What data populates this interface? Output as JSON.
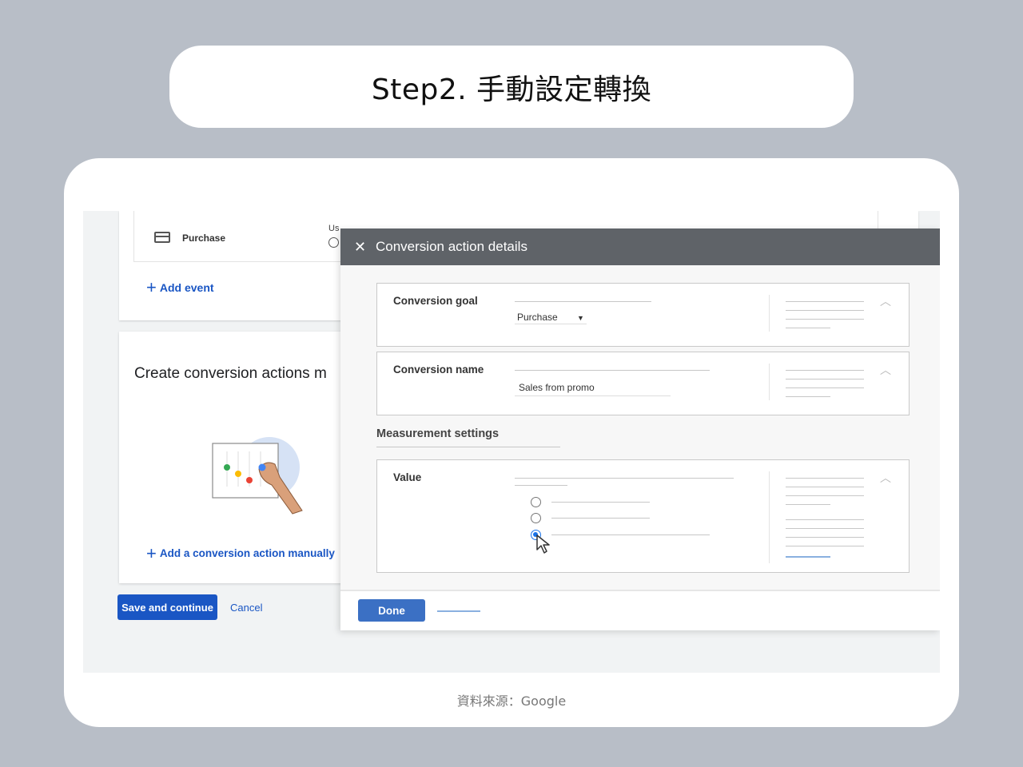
{
  "slide": {
    "title": "Step2. 手動設定轉換",
    "source": "資料來源：Google"
  },
  "background_page": {
    "event_row": {
      "icon": "credit-card-icon",
      "label": "Purchase",
      "cut_text": "Us"
    },
    "add_event": "Add event",
    "create_title": "Create conversion actions m",
    "add_manual": "Add a conversion action manually",
    "save_button": "Save and continue",
    "cancel_button": "Cancel"
  },
  "dialog": {
    "title": "Conversion action details",
    "close_icon": "close-icon",
    "sections": {
      "goal": {
        "label": "Conversion goal",
        "value": "Purchase"
      },
      "name": {
        "label": "Conversion name",
        "value": "Sales from promo"
      },
      "measurement_title": "Measurement settings",
      "value": {
        "label": "Value",
        "selected_option_index": 2
      }
    },
    "done_button": "Done"
  },
  "colors": {
    "accent_blue": "#1a56c4",
    "header_gray": "#5f6368",
    "slide_bg": "#b8bec7"
  }
}
